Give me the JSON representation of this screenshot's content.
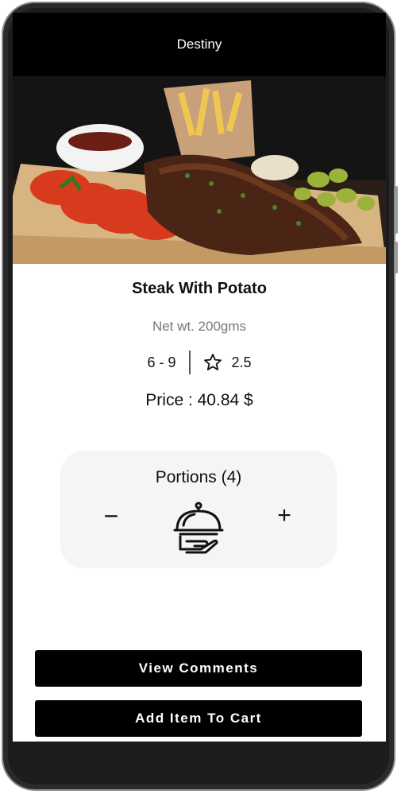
{
  "app": {
    "title": "Destiny"
  },
  "product": {
    "name": "Steak With Potato",
    "net_weight": "Net wt. 200gms",
    "range": "6 - 9",
    "rating": "2.5",
    "price": "Price : 40.84 $"
  },
  "portions": {
    "label": "Portions (4)",
    "minus": "−",
    "plus": "+"
  },
  "actions": {
    "view_comments": "View Comments",
    "add_to_cart": "Add Item To Cart"
  },
  "icons": {
    "rating": "star-outline-icon",
    "portion": "serving-cloche-icon",
    "image": "steak-photo"
  },
  "colors": {
    "appbar": "#000000",
    "button": "#000000",
    "card": "#f5f5f5"
  }
}
